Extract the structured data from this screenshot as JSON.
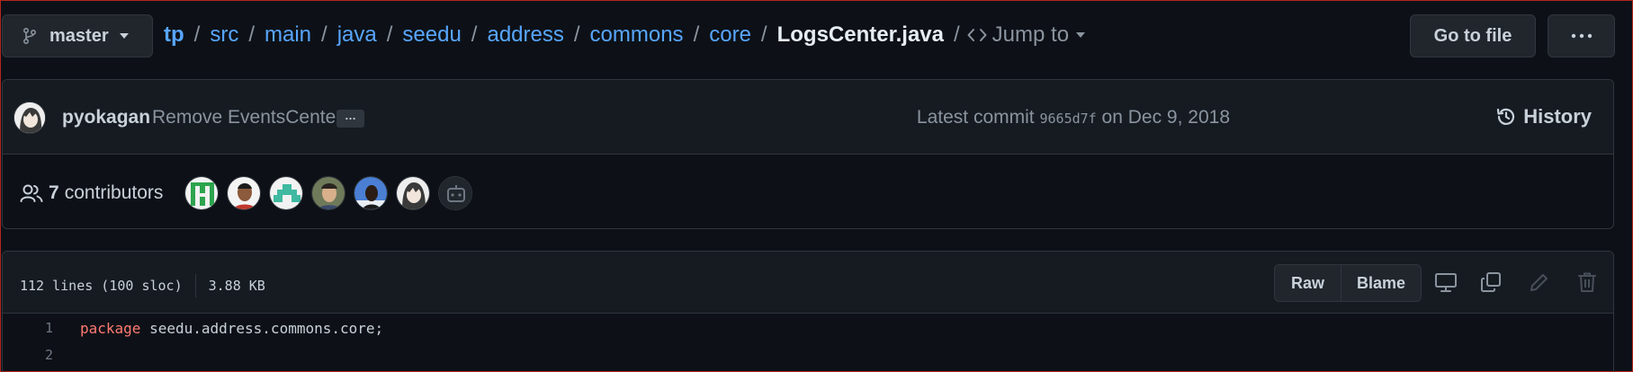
{
  "branch": {
    "name": "master",
    "icon": "git-branch-icon"
  },
  "breadcrumb": {
    "root": "tp",
    "segments": [
      "src",
      "main",
      "java",
      "seedu",
      "address",
      "commons",
      "core"
    ],
    "file": "LogsCenter.java",
    "separator": "/"
  },
  "jump_to": {
    "label": "Jump to",
    "icon": "code-icon"
  },
  "header_actions": {
    "go_to_file": "Go to file",
    "more_icon": "kebab-horizontal-icon"
  },
  "commit": {
    "author": "pyokagan",
    "message": "Remove EventsCenter",
    "ellipsis": "…",
    "latest_label": "Latest commit",
    "sha": "9665d7f",
    "date_prefix": "on",
    "date": "Dec 9, 2018",
    "history_label": "History"
  },
  "contributors": {
    "count": "7",
    "label": "contributors",
    "avatar_colors": [
      "#2da44e",
      "#8c5a3c",
      "#3fb9a0",
      "#a0845c",
      "#4a7fd4",
      "#dddddd",
      "#30363d"
    ]
  },
  "file": {
    "lines_info": "112 lines (100 sloc)",
    "size": "3.88 KB",
    "raw_label": "Raw",
    "blame_label": "Blame"
  },
  "code": {
    "lines": [
      {
        "num": "1",
        "keyword": "package",
        "rest": " seedu.address.commons.core;"
      },
      {
        "num": "2",
        "keyword": "",
        "rest": ""
      }
    ]
  },
  "colors": {
    "link": "#58a6ff",
    "keyword": "#ff7b72",
    "background": "#0d1117",
    "panel": "#161b22"
  }
}
